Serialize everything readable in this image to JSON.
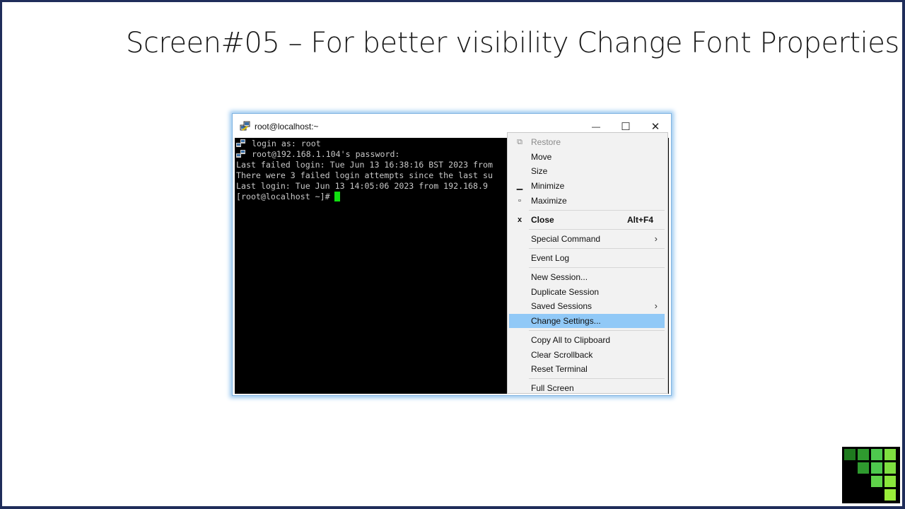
{
  "slide": {
    "title": "Screen#05 – For better visibility Change Font Properties"
  },
  "window": {
    "title": "root@localhost:~",
    "app_icon": "putty-icon",
    "controls": {
      "minimize": "—",
      "maximize": "☐",
      "close": "✕"
    }
  },
  "terminal": {
    "lines": [
      "login as: root",
      "root@192.168.1.104's password:",
      "Last failed login: Tue Jun 13 16:38:16 BST 2023 from",
      "There were 3 failed login attempts since the last su",
      "Last login: Tue Jun 13 14:05:06 2023 from 192.168.9",
      "[root@localhost ~]#"
    ]
  },
  "menu": {
    "items": [
      {
        "label": "Restore",
        "icon": "restore-icon",
        "glyph": "⧉"
      },
      {
        "label": "Move"
      },
      {
        "label": "Size"
      },
      {
        "label": "Minimize",
        "icon": "minimize-icon",
        "glyph": "▁"
      },
      {
        "label": "Maximize",
        "icon": "maximize-icon",
        "glyph": "▫"
      },
      {
        "label": "Close",
        "icon": "close-icon",
        "glyph": "x",
        "shortcut": "Alt+F4"
      },
      {
        "label": "Special Command"
      },
      {
        "label": "Event Log"
      },
      {
        "label": "New Session..."
      },
      {
        "label": "Duplicate Session"
      },
      {
        "label": "Saved Sessions"
      },
      {
        "label": "Change Settings..."
      },
      {
        "label": "Copy All to Clipboard"
      },
      {
        "label": "Clear Scrollback"
      },
      {
        "label": "Reset Terminal"
      },
      {
        "label": "Full Screen"
      }
    ],
    "submenu_arrow": "›"
  },
  "colors": {
    "terminal_bg": "#000000",
    "terminal_text": "#c8c8c8",
    "cursor": "#10e010",
    "highlight": "#91c9f7",
    "slide_border": "#1f2d5a"
  }
}
